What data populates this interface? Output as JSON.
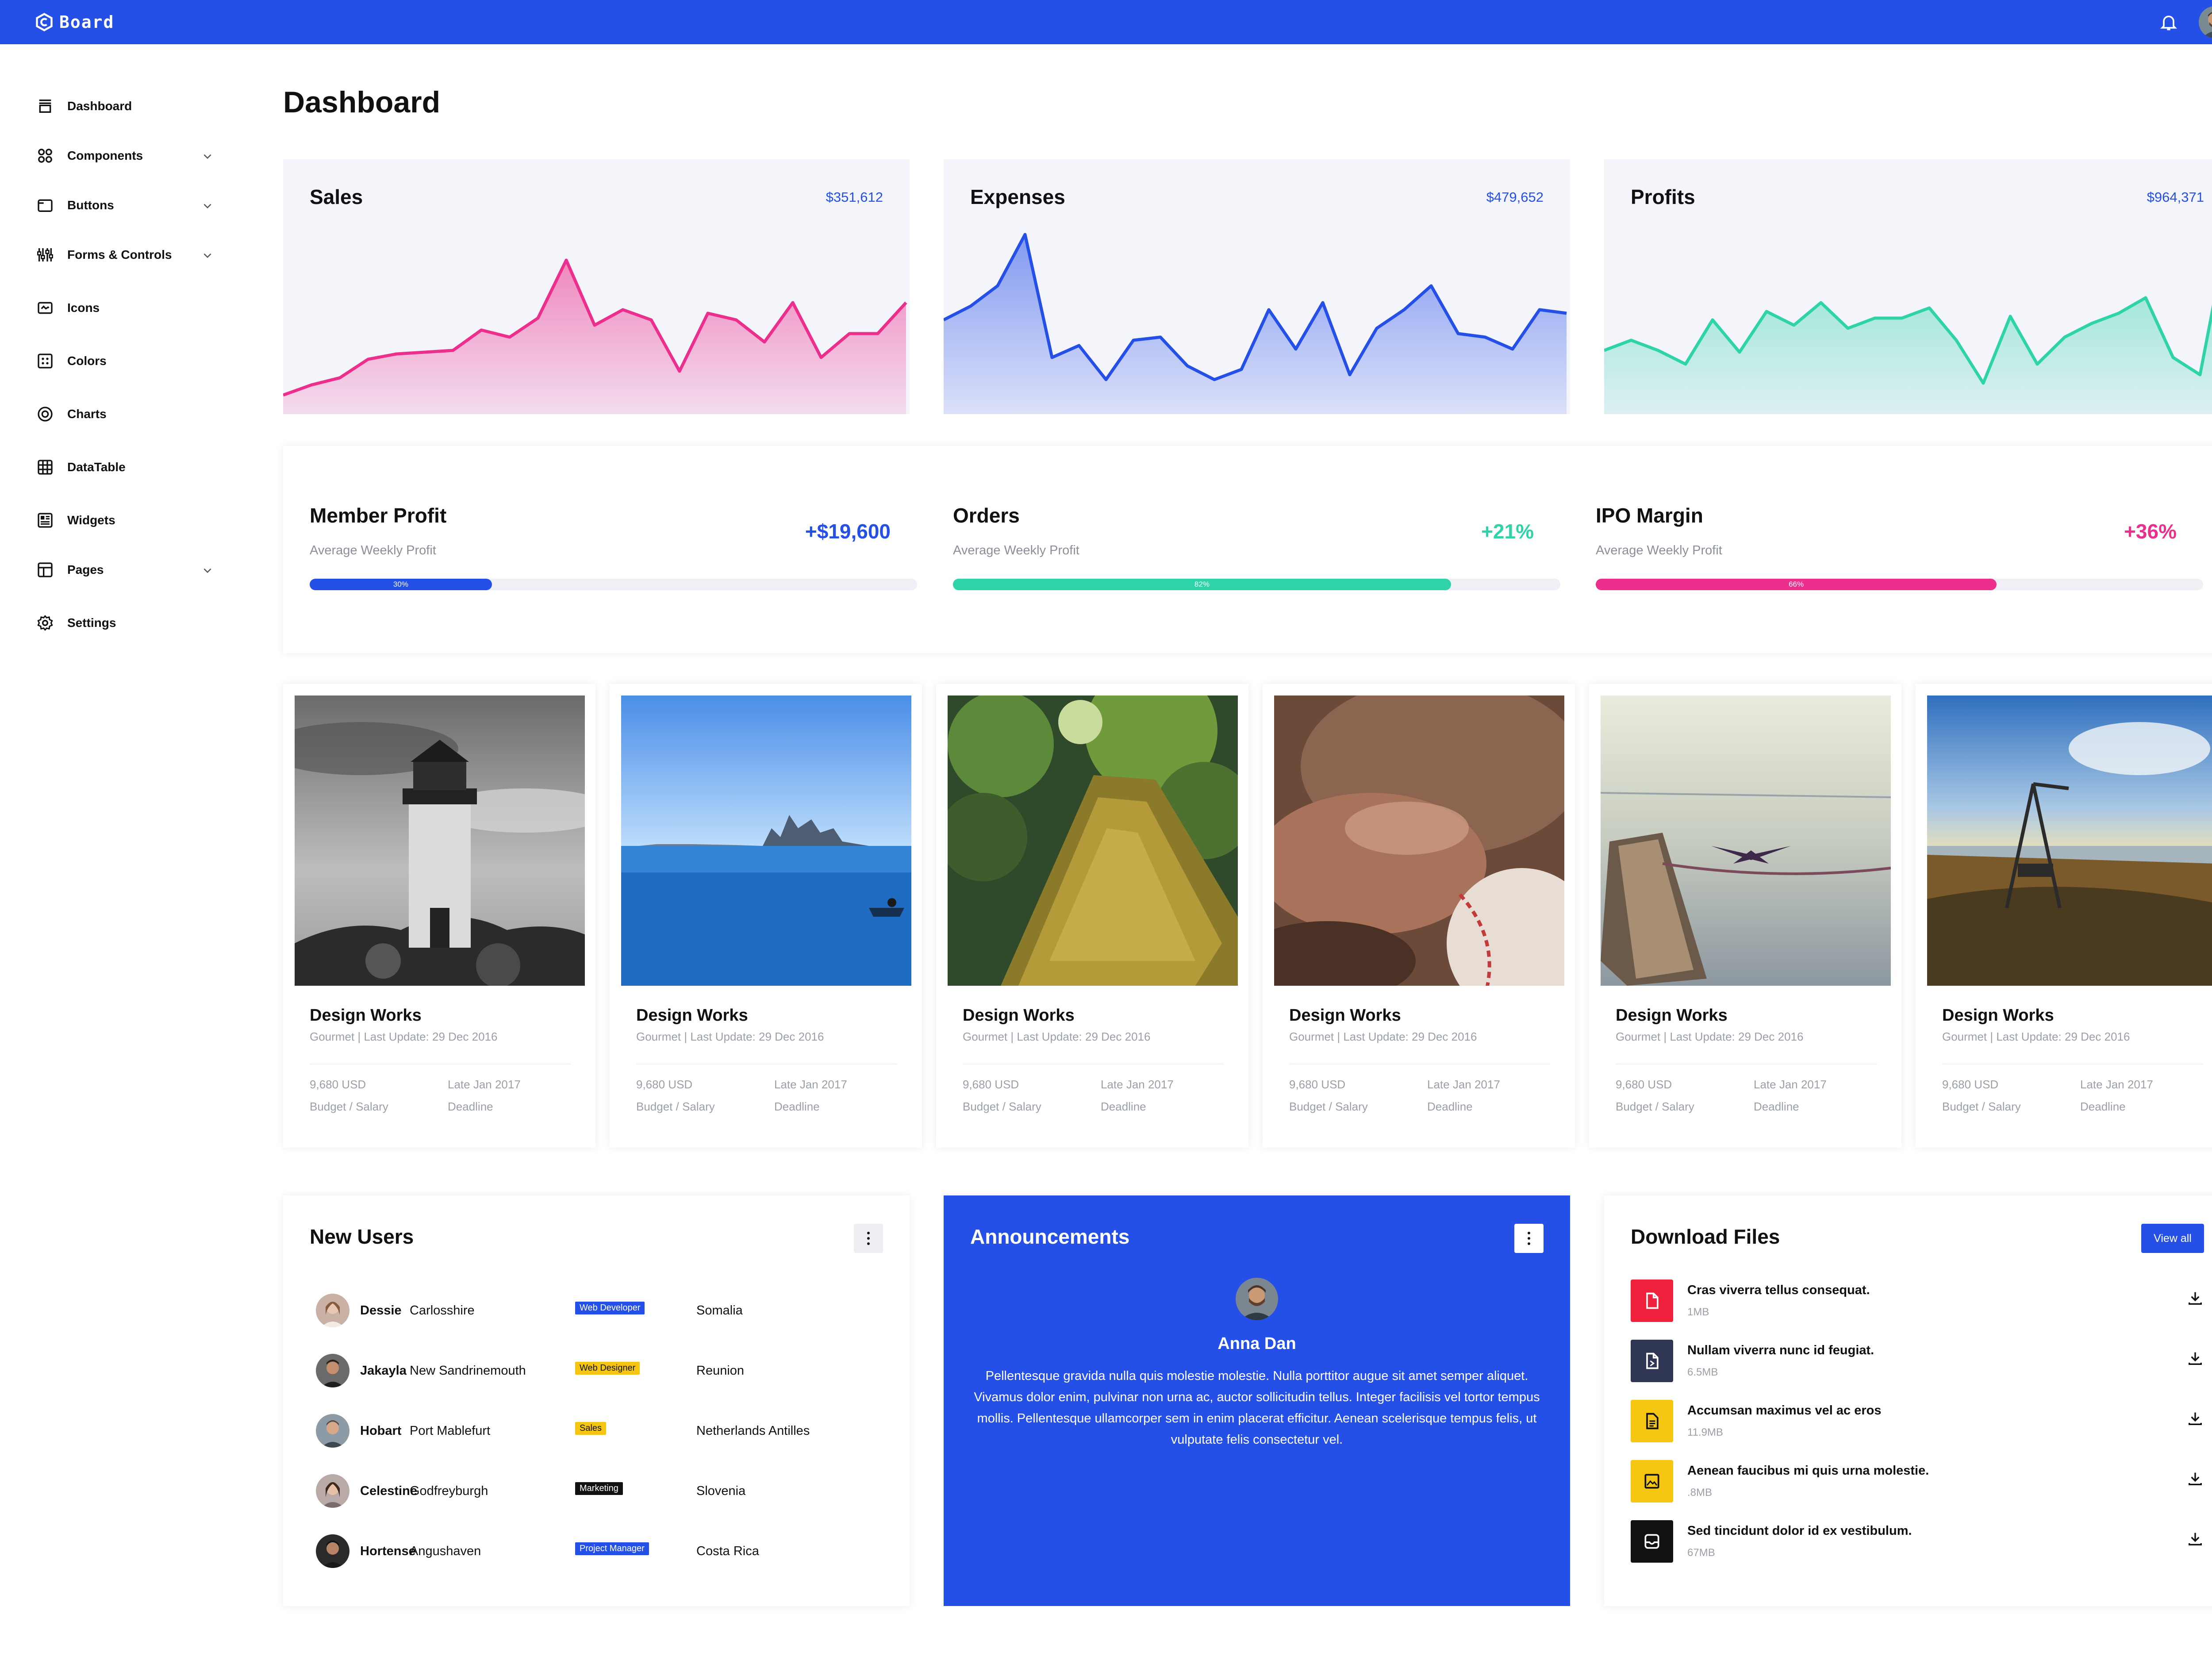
{
  "app": {
    "name": "Board"
  },
  "colors": {
    "primary": "#2450e8",
    "pink": "#ec2f8c",
    "teal": "#2ed3a7",
    "yellow": "#f4c511",
    "red": "#f0213c",
    "slate": "#2e3654",
    "black": "#111111"
  },
  "sidebar": {
    "items": [
      {
        "label": "Dashboard",
        "icon": "archive-icon",
        "expandable": false
      },
      {
        "label": "Components",
        "icon": "grid-circles-icon",
        "expandable": true
      },
      {
        "label": "Buttons",
        "icon": "window-icon",
        "expandable": true
      },
      {
        "label": "Forms & Controls",
        "icon": "sliders-icon",
        "expandable": true
      },
      {
        "label": "Icons",
        "icon": "image-icon",
        "expandable": false
      },
      {
        "label": "Colors",
        "icon": "palette-icon",
        "expandable": false
      },
      {
        "label": "Charts",
        "icon": "chart-circle-icon",
        "expandable": false
      },
      {
        "label": "DataTable",
        "icon": "table-icon",
        "expandable": false
      },
      {
        "label": "Widgets",
        "icon": "widgets-icon",
        "expandable": false
      },
      {
        "label": "Pages",
        "icon": "pages-icon",
        "expandable": true
      },
      {
        "label": "Settings",
        "icon": "gear-icon",
        "expandable": false
      }
    ]
  },
  "page": {
    "title": "Dashboard"
  },
  "stats": [
    {
      "title": "Sales",
      "value": "$351,612",
      "color": "#ec2f8c",
      "series": [
        6,
        12,
        16,
        27,
        30,
        31,
        32,
        44,
        40,
        51,
        85,
        47,
        56,
        50,
        20,
        54,
        50,
        37,
        60,
        28,
        42,
        42,
        60
      ]
    },
    {
      "title": "Expenses",
      "value": "$479,652",
      "color": "#2450e8",
      "series": [
        50,
        58,
        70,
        100,
        28,
        35,
        15,
        38,
        40,
        23,
        15,
        21,
        56,
        33,
        60,
        18,
        45,
        56,
        70,
        42,
        40,
        33,
        56,
        54
      ]
    },
    {
      "title": "Profits",
      "value": "$964,371",
      "color": "#2ed3a7",
      "series": [
        32,
        38,
        32,
        24,
        50,
        31,
        55,
        47,
        60,
        45,
        51,
        51,
        57,
        38,
        13,
        52,
        24,
        40,
        48,
        54,
        63,
        28,
        18,
        100
      ]
    }
  ],
  "metrics": [
    {
      "title": "Member Profit",
      "subtitle": "Average Weekly Profit",
      "value": "+$19,600",
      "progress": 30,
      "progress_label": "30%",
      "color": "#2450e8"
    },
    {
      "title": "Orders",
      "subtitle": "Average Weekly Profit",
      "value": "+21%",
      "progress": 82,
      "progress_label": "82%",
      "color": "#2ed3a7"
    },
    {
      "title": "IPO Margin",
      "subtitle": "Average Weekly Profit",
      "value": "+36%",
      "progress": 66,
      "progress_label": "66%",
      "color": "#ec2f8c"
    }
  ],
  "projects": [
    {
      "title": "Design Works",
      "subtitle": "Gourmet | Last Update: 29 Dec 2016",
      "budget": "9,680 USD",
      "budget_label": "Budget / Salary",
      "deadline": "Late Jan 2017",
      "deadline_label": "Deadline"
    },
    {
      "title": "Design Works",
      "subtitle": "Gourmet | Last Update: 29 Dec 2016",
      "budget": "9,680 USD",
      "budget_label": "Budget / Salary",
      "deadline": "Late Jan 2017",
      "deadline_label": "Deadline"
    },
    {
      "title": "Design Works",
      "subtitle": "Gourmet | Last Update: 29 Dec 2016",
      "budget": "9,680 USD",
      "budget_label": "Budget / Salary",
      "deadline": "Late Jan 2017",
      "deadline_label": "Deadline"
    },
    {
      "title": "Design Works",
      "subtitle": "Gourmet | Last Update: 29 Dec 2016",
      "budget": "9,680 USD",
      "budget_label": "Budget / Salary",
      "deadline": "Late Jan 2017",
      "deadline_label": "Deadline"
    },
    {
      "title": "Design Works",
      "subtitle": "Gourmet | Last Update: 29 Dec 2016",
      "budget": "9,680 USD",
      "budget_label": "Budget / Salary",
      "deadline": "Late Jan 2017",
      "deadline_label": "Deadline"
    },
    {
      "title": "Design Works",
      "subtitle": "Gourmet | Last Update: 29 Dec 2016",
      "budget": "9,680 USD",
      "budget_label": "Budget / Salary",
      "deadline": "Late Jan 2017",
      "deadline_label": "Deadline"
    }
  ],
  "new_users": {
    "title": "New Users",
    "rows": [
      {
        "name": "Dessie",
        "city": "Carlosshire",
        "role": "Web Developer",
        "country": "Somalia"
      },
      {
        "name": "Jakayla",
        "city": "New Sandrinemouth",
        "role": "Web Designer",
        "country": "Reunion"
      },
      {
        "name": "Hobart",
        "city": "Port Mablefurt",
        "role": "Sales",
        "country": "Netherlands Antilles"
      },
      {
        "name": "Celestine",
        "city": "Godfreyburgh",
        "role": "Marketing",
        "country": "Slovenia"
      },
      {
        "name": "Hortense",
        "city": "Angushaven",
        "role": "Project Manager",
        "country": "Costa Rica"
      }
    ]
  },
  "announcements": {
    "title": "Announcements",
    "author": "Anna Dan",
    "text": "Pellentesque gravida nulla quis molestie molestie. Nulla porttitor augue sit amet semper aliquet. Vivamus dolor enim, pulvinar non urna ac, auctor sollicitudin tellus. Integer facilisis vel tortor tempus mollis. Pellentesque ullamcorper sem in enim placerat efficitur. Aenean scelerisque tempus felis, ut vulputate felis consectetur vel."
  },
  "downloads": {
    "title": "Download Files",
    "view_all": "View all",
    "files": [
      {
        "name": "Cras viverra tellus consequat.",
        "size": "1MB",
        "icon": "pdf-file-icon"
      },
      {
        "name": "Nullam viverra nunc id feugiat.",
        "size": "6.5MB",
        "icon": "doc-file-icon"
      },
      {
        "name": "Accumsan maximus vel ac eros",
        "size": "11.9MB",
        "icon": "text-file-icon"
      },
      {
        "name": "Aenean faucibus mi quis urna molestie.",
        "size": ".8MB",
        "icon": "image-file-icon"
      },
      {
        "name": "Sed tincidunt dolor id ex vestibulum.",
        "size": "67MB",
        "icon": "inbox-file-icon"
      }
    ]
  }
}
